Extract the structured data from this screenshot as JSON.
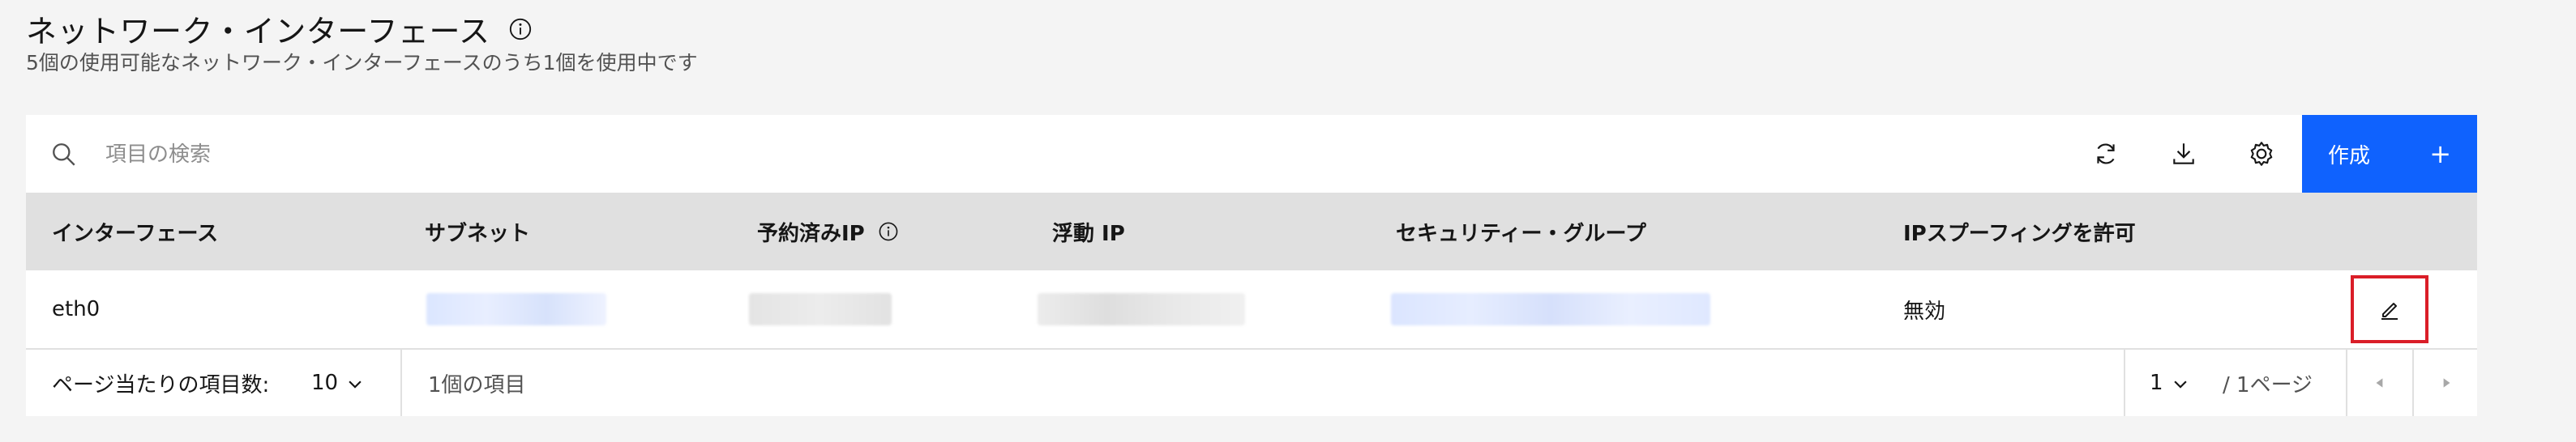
{
  "header": {
    "title": "ネットワーク・インターフェース",
    "subtitle": "5個の使用可能なネットワーク・インターフェースのうち1個を使用中です"
  },
  "toolbar": {
    "search_placeholder": "項目の検索",
    "create_label": "作成",
    "create_icon": "+"
  },
  "table": {
    "columns": [
      {
        "label": "インターフェース"
      },
      {
        "label": "サブネット"
      },
      {
        "label": "予約済みIP",
        "has_info_icon": true
      },
      {
        "label": "浮動 IP"
      },
      {
        "label": "セキュリティー・グループ"
      },
      {
        "label": "IPスプーフィングを許可"
      }
    ],
    "rows": [
      {
        "interface": "eth0",
        "ip_spoofing": "無効"
      }
    ]
  },
  "pagination": {
    "items_per_page_label": "ページ当たりの項目数:",
    "items_per_page_value": "10",
    "item_count": "1個の項目",
    "current_page": "1",
    "total_pages_label": "/ 1ページ"
  },
  "colors": {
    "primary": "#0f62fe",
    "highlight_border": "#da1e28",
    "header_bg": "#e0e0e0",
    "page_bg": "#f4f4f4"
  }
}
